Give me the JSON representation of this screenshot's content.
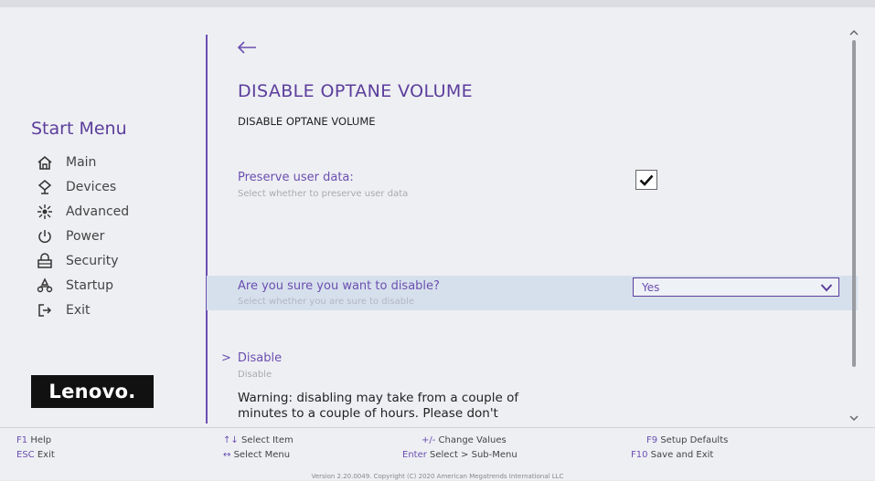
{
  "sidebar": {
    "title": "Start Menu",
    "items": [
      {
        "label": "Main",
        "icon": "home-icon"
      },
      {
        "label": "Devices",
        "icon": "devices-icon"
      },
      {
        "label": "Advanced",
        "icon": "advanced-icon"
      },
      {
        "label": "Power",
        "icon": "power-icon"
      },
      {
        "label": "Security",
        "icon": "security-icon"
      },
      {
        "label": "Startup",
        "icon": "startup-icon"
      },
      {
        "label": "Exit",
        "icon": "exit-icon"
      }
    ],
    "logo": "Lenovo."
  },
  "main": {
    "title": "DISABLE OPTANE VOLUME",
    "subtitle": "DISABLE OPTANE VOLUME",
    "preserve": {
      "label": "Preserve user data:",
      "help": "Select whether to preserve user data",
      "checked": true
    },
    "confirm": {
      "label": "Are you sure you want to disable?",
      "help": "Select whether you are sure to disable",
      "value": "Yes"
    },
    "disable": {
      "label": "Disable",
      "help": "Disable"
    },
    "warning_line1": "Warning: disabling may take from a couple of",
    "warning_line2": "minutes to a couple of hours. Please don't"
  },
  "footer": {
    "items": [
      {
        "key": "F1",
        "text": "Help"
      },
      {
        "key": "ESC",
        "text": "Exit"
      },
      {
        "key": "↑↓",
        "text": "Select Item"
      },
      {
        "key": "↔",
        "text": "Select Menu"
      },
      {
        "key": "+/-",
        "text": "Change Values"
      },
      {
        "key": "Enter",
        "text": "Select > Sub-Menu"
      },
      {
        "key": "F9",
        "text": "Setup Defaults"
      },
      {
        "key": "F10",
        "text": "Save and Exit"
      }
    ],
    "version": "Version 2.20.0049. Copyright (C) 2020 American Megatrends International LLC"
  },
  "colors": {
    "accent": "#5b3d9c",
    "highlight": "#d6e0ec"
  }
}
